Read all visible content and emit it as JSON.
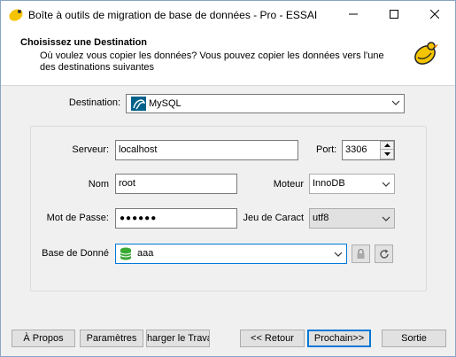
{
  "window": {
    "title": "Boîte à outils de migration de base de données - Pro - ESSAI"
  },
  "header": {
    "title": "Choisissez une Destination",
    "description": "Où voulez vous copier les données? Vous pouvez copier les données vers l'une des destinations suivantes"
  },
  "destination": {
    "label": "Destination:",
    "value": "MySQL"
  },
  "form": {
    "server_label": "Serveur:",
    "server_value": "localhost",
    "port_label": "Port:",
    "port_value": "3306",
    "name_label": "Nom",
    "name_value": "root",
    "engine_label": "Moteur",
    "engine_value": "InnoDB",
    "password_label": "Mot de Passe:",
    "password_mask": "●●●●●●",
    "charset_label": "Jeu de Caract",
    "charset_value": "utf8",
    "database_label": "Base de Donné",
    "database_value": "aaa"
  },
  "buttons": {
    "about": "À Propos",
    "settings": "Paramètres",
    "load_task": "Charger le Travail",
    "back": "<< Retour",
    "next": "Prochain>>",
    "exit": "Sortie"
  },
  "colors": {
    "accent": "#0078d7",
    "mysql_blue": "#00618a",
    "db_green": "#3aaa35",
    "logo_yellow": "#f5c400"
  },
  "icons": {
    "app": "rubber-duck-icon",
    "destination": "mysql-dolphin-icon",
    "database": "database-green-icon",
    "lock": "lock-icon",
    "refresh": "refresh-icon"
  }
}
